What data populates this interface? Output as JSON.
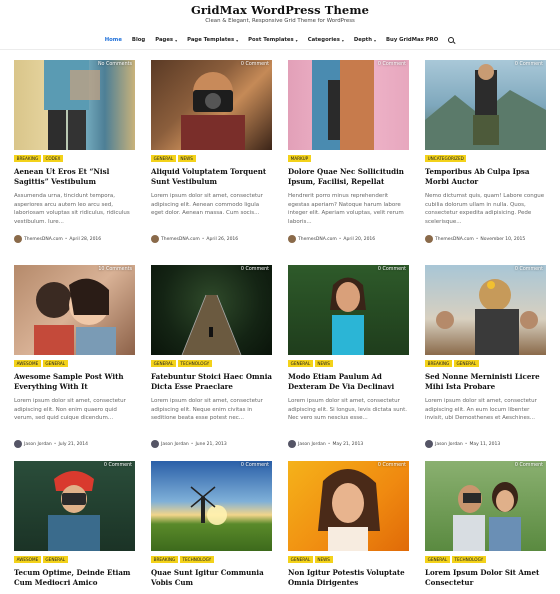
{
  "site": {
    "title": "GridMax WordPress Theme",
    "tagline": "Clean & Elegant, Responsive Grid Theme for WordPress"
  },
  "nav": {
    "items": [
      {
        "label": "Home",
        "active": true,
        "dropdown": false
      },
      {
        "label": "Blog",
        "active": false,
        "dropdown": false
      },
      {
        "label": "Pages",
        "active": false,
        "dropdown": true
      },
      {
        "label": "Page Templates",
        "active": false,
        "dropdown": true
      },
      {
        "label": "Post Templates",
        "active": false,
        "dropdown": true
      },
      {
        "label": "Categories",
        "active": false,
        "dropdown": true
      },
      {
        "label": "Depth",
        "active": false,
        "dropdown": true
      },
      {
        "label": "Buy GridMax PRO",
        "active": false,
        "dropdown": false
      }
    ],
    "search_icon": "search-icon",
    "caret": "▾"
  },
  "posts": [
    {
      "comment": "No Comments",
      "categories": [
        "BREAKING",
        "CODEX"
      ],
      "title": "Aenean Ut Eros Et “Nisl Sagittis” Vestibulum",
      "excerpt": "Assumenda urna, tincidunt tempora, asperiores arcu autem leo arcu sed, laboriosam voluptas sit ridiculus, ridiculus vestibulum. Iure...",
      "author": "ThemesDNA.com",
      "date": "April 28, 2016"
    },
    {
      "comment": "0 Comment",
      "categories": [
        "GENERAL",
        "NEWS"
      ],
      "title": "Aliquid Voluptatem Torquent Sunt Vestibulum",
      "excerpt": "Lorem ipsum dolor sit amet, consectetur adipiscing elit. Aenean commodo ligula eget dolor. Aenean massa. Cum socis...",
      "author": "ThemesDNA.com",
      "date": "April 26, 2016"
    },
    {
      "comment": "0 Comment",
      "categories": [
        "MARKUP"
      ],
      "title": "Dolore Quae Nec Sollicitudin Ipsum, Facilisi, Repellat",
      "excerpt": "Hendrerit porro minus reprehenderit egestas aperiam? Natoque harum labore integer elit. Aperiam voluptas, velit rerum laboris...",
      "author": "ThemesDNA.com",
      "date": "April 20, 2016"
    },
    {
      "comment": "0 Comment",
      "categories": [
        "UNCATEGORIZED"
      ],
      "title": "Temporibus Ab Culpa Ipsa Morbi Auctor",
      "excerpt": "Nemo dictumst quis, quam! Labore congue cubilia dolorum ullam in nulla. Quos, consectetur expedita adipisicing. Pede scelerisque...",
      "author": "ThemesDNA.com",
      "date": "November 10, 2015"
    },
    {
      "comment": "10 Comments",
      "categories": [
        "AWESOME",
        "GENERAL"
      ],
      "title": "Awesome Sample Post With Everything With It",
      "excerpt": "Lorem ipsum dolor sit amet, consectetur adipiscing elit. Non enim quaero quid verum, sed quid cuique dicendum...",
      "author": "Jason Jordan",
      "date": "July 21, 2014"
    },
    {
      "comment": "0 Comment",
      "categories": [
        "GENERAL",
        "TECHNOLOGY"
      ],
      "title": "Fatebuntur Stoici Haec Omnia Dicta Esse Praeclare",
      "excerpt": "Lorem ipsum dolor sit amet, consectetur adipiscing elit. Neque enim civitas in seditione beata esse potest nec...",
      "author": "Jason Jordan",
      "date": "June 21, 2013"
    },
    {
      "comment": "0 Comment",
      "categories": [
        "GENERAL",
        "NEWS"
      ],
      "title": "Modo Etiam Paulum Ad Dexteram De Via Declinavi",
      "excerpt": "Lorem ipsum dolor sit amet, consectetur adipiscing elit. Si longus, levis dictata sunt. Nec vero sum nescius esse...",
      "author": "Jason Jordan",
      "date": "May 21, 2013"
    },
    {
      "comment": "0 Comment",
      "categories": [
        "BREAKING",
        "GENERAL"
      ],
      "title": "Sed Nonne Merninisti Licere Mihi Ista Probare",
      "excerpt": "Lorem ipsum dolor sit amet, consectetur adipiscing elit. An eum locum libenter invisit, ubi Demosthenes et Aeschines...",
      "author": "Jason Jordan",
      "date": "May 11, 2013"
    },
    {
      "comment": "0 Comment",
      "categories": [
        "AWESOME",
        "GENERAL"
      ],
      "title": "Tecum Optime, Deinde Etiam Cum Mediocri Amico",
      "excerpt": "",
      "author": "",
      "date": ""
    },
    {
      "comment": "0 Comment",
      "categories": [
        "BREAKING",
        "TECHNOLOGY"
      ],
      "title": "Quae Sunt Igitur Communia Vobis Cum",
      "excerpt": "",
      "author": "",
      "date": ""
    },
    {
      "comment": "0 Comment",
      "categories": [
        "GENERAL",
        "NEWS"
      ],
      "title": "Non Igitur Potestis Voluptate Omnia Dirigentes",
      "excerpt": "",
      "author": "",
      "date": ""
    },
    {
      "comment": "0 Comment",
      "categories": [
        "GENERAL",
        "TECHNOLOGY"
      ],
      "title": "Lorem Ipsum Dolor Sit Amet Consectetur",
      "excerpt": "",
      "author": "",
      "date": ""
    }
  ],
  "colors": {
    "accent": "#1e6fd9",
    "category_badge": "#f3d21a"
  }
}
